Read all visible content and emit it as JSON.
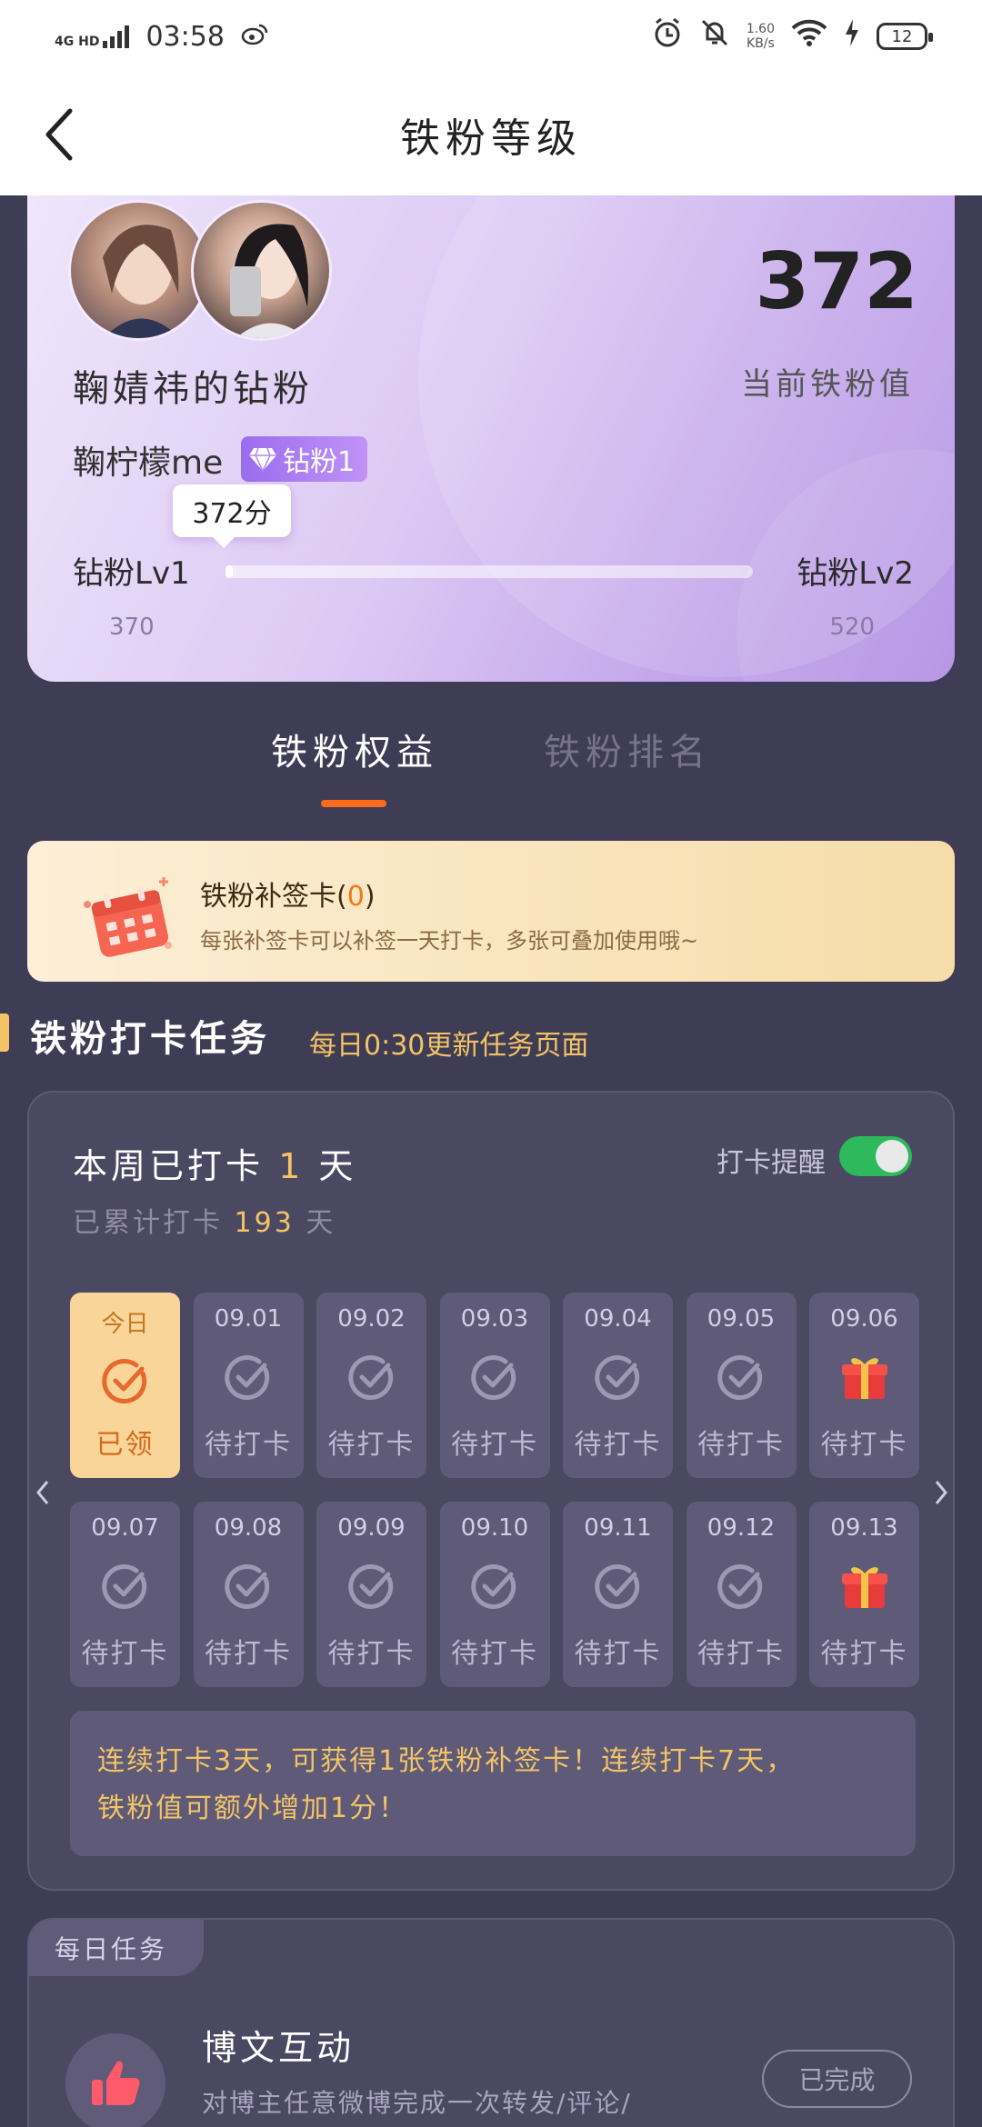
{
  "status_bar": {
    "network": "4G HD",
    "time": "03:58",
    "speed_value": "1.60",
    "speed_unit": "KB/s",
    "battery": "12"
  },
  "header": {
    "title": "铁粉等级"
  },
  "profile": {
    "group_name": "鞠婧祎的钻粉",
    "score": "372",
    "score_label": "当前铁粉值",
    "nickname": "鞠柠檬me",
    "badge_label": "钻粉1",
    "tip": "372分",
    "level_current": "钻粉Lv1",
    "level_next": "钻粉Lv2",
    "level_min": "370",
    "level_max": "520",
    "progress_fraction": 0.013
  },
  "tabs": [
    {
      "label": "铁粉权益",
      "active": true
    },
    {
      "label": "铁粉排名",
      "active": false
    }
  ],
  "makeup_card": {
    "title": "铁粉补签卡(",
    "count": "0",
    "title_end": ")",
    "desc": "每张补签卡可以补签一天打卡，多张可叠加使用哦~"
  },
  "section": {
    "title": "铁粉打卡任务",
    "subtitle": "每日0:30更新任务页面"
  },
  "checkin": {
    "week_prefix": "本周已打卡",
    "week_count": "1",
    "week_suffix": "天",
    "total_prefix": "已累计打卡",
    "total_count": "193",
    "total_suffix": "天",
    "remind_label": "打卡提醒",
    "remind_on": true,
    "days": [
      {
        "date": "今日",
        "status": "已领",
        "icon": "check-icon",
        "today": true
      },
      {
        "date": "09.01",
        "status": "待打卡",
        "icon": "check-icon"
      },
      {
        "date": "09.02",
        "status": "待打卡",
        "icon": "check-icon"
      },
      {
        "date": "09.03",
        "status": "待打卡",
        "icon": "check-icon"
      },
      {
        "date": "09.04",
        "status": "待打卡",
        "icon": "check-icon"
      },
      {
        "date": "09.05",
        "status": "待打卡",
        "icon": "check-icon"
      },
      {
        "date": "09.06",
        "status": "待打卡",
        "icon": "gift-icon"
      },
      {
        "date": "09.07",
        "status": "待打卡",
        "icon": "check-icon"
      },
      {
        "date": "09.08",
        "status": "待打卡",
        "icon": "check-icon"
      },
      {
        "date": "09.09",
        "status": "待打卡",
        "icon": "check-icon"
      },
      {
        "date": "09.10",
        "status": "待打卡",
        "icon": "check-icon"
      },
      {
        "date": "09.11",
        "status": "待打卡",
        "icon": "check-icon"
      },
      {
        "date": "09.12",
        "status": "待打卡",
        "icon": "check-icon"
      },
      {
        "date": "09.13",
        "status": "待打卡",
        "icon": "gift-icon"
      }
    ],
    "tip_line1": "连续打卡3天，可获得1张铁粉补签卡！连续打卡7天，",
    "tip_line2": "铁粉值可额外增加1分！"
  },
  "daily_task": {
    "tag": "每日任务",
    "title": "博文互动",
    "desc": "对博主任意微博完成一次转发/评论/",
    "button": "已完成"
  },
  "colors": {
    "page_bg": "#3f3c55",
    "accent_orange": "#ff6a1a",
    "accent_gold": "#f3c466",
    "toggle_on": "#2db95c"
  }
}
